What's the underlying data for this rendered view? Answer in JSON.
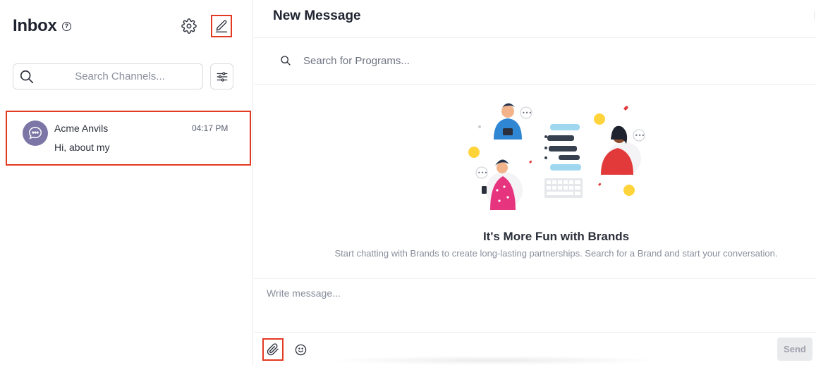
{
  "inbox": {
    "title": "Inbox",
    "help_glyph": "?",
    "search_placeholder": "Search Channels...",
    "icons": {
      "help": "help-circle-icon",
      "settings": "gear-icon",
      "compose": "pencil-icon",
      "search": "search-icon",
      "filter": "sliders-icon"
    }
  },
  "channels": [
    {
      "name": "Acme Anvils",
      "time": "04:17 PM",
      "preview": "Hi, about my",
      "avatar_icon": "chat-bubble-icon",
      "avatar_color": "#7b76a6"
    }
  ],
  "conversation": {
    "title": "New Message",
    "program_search_placeholder": "Search for Programs...",
    "empty_state": {
      "title": "It's More Fun with Brands",
      "subtitle": "Start chatting with Brands to create long-lasting partnerships. Search for a Brand and start your conversation."
    },
    "composer": {
      "placeholder": "Write message...",
      "send_label": "Send",
      "attach_icon": "paperclip-icon",
      "emoji_icon": "smiley-icon"
    }
  },
  "colors": {
    "highlight": "#e23a22",
    "avatar": "#7b76a6",
    "send_disabled_bg": "#e9eaec"
  }
}
